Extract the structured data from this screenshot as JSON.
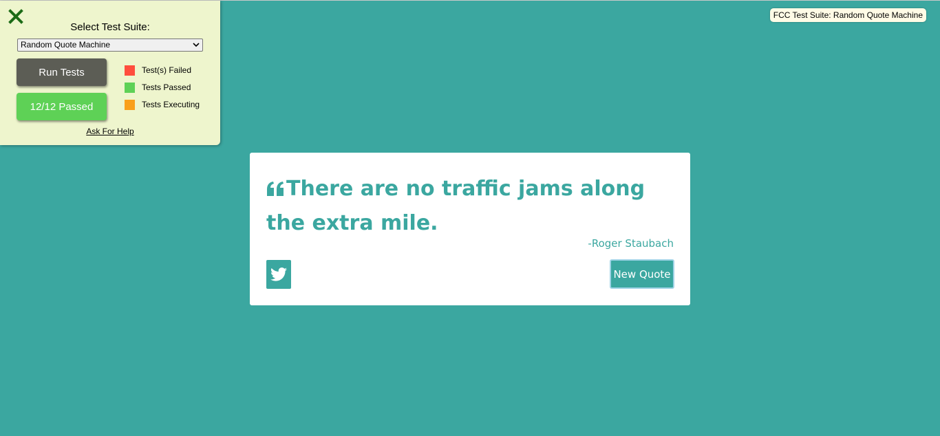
{
  "fcc_panel": {
    "close_icon": "close-icon",
    "select_label": "Select Test Suite:",
    "selected_suite": "Random Quote Machine",
    "run_tests_label": "Run Tests",
    "result_label": "12/12 Passed",
    "legend": [
      {
        "label": "Test(s) Failed",
        "color": "#ff4e3d"
      },
      {
        "label": "Tests Passed",
        "color": "#5ed156"
      },
      {
        "label": "Tests Executing",
        "color": "#f9a01b"
      }
    ],
    "help_link": "Ask For Help",
    "colors": {
      "panel_bg": "#eef5cd",
      "run_button": "#5c5d55",
      "pass_button": "#5ed156"
    }
  },
  "suite_badge": "FCC Test Suite: Random Quote Machine",
  "quote_box": {
    "quote_icon": "quote-left-icon",
    "quote": "There are no traffic jams along the extra mile.",
    "author": "-Roger Staubach",
    "tweet_icon": "twitter-icon",
    "new_quote_label": "New Quote",
    "accent_color": "#3ba7a0"
  }
}
